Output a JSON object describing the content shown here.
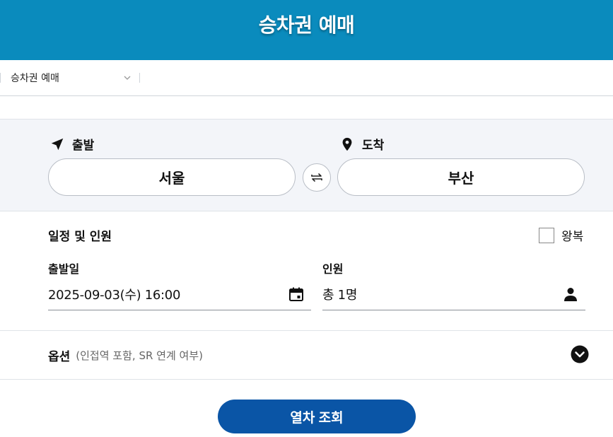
{
  "header": {
    "title": "승차권 예매"
  },
  "breadcrumb": {
    "selected": "승차권 예매"
  },
  "stations": {
    "departure_label": "출발",
    "departure_value": "서울",
    "arrival_label": "도착",
    "arrival_value": "부산"
  },
  "schedule": {
    "title": "일정 및 인원",
    "round_trip_label": "왕복",
    "round_trip_checked": false,
    "date_label": "출발일",
    "date_value": "2025-09-03(수) 16:00",
    "passengers_label": "인원",
    "passengers_value": "총 1명"
  },
  "options": {
    "title": "옵션",
    "subtitle": "(인접역 포함, SR 연계 여부)"
  },
  "actions": {
    "search_label": "열차 조회"
  },
  "colors": {
    "header_bg": "#0a8bbd",
    "station_bg": "#f3f5f9",
    "search_button": "#0a55a6"
  },
  "icons": {
    "departure": "navigation-arrow-icon",
    "arrival": "map-pin-icon",
    "swap": "swap-arrows-icon",
    "calendar": "calendar-icon",
    "person": "person-icon",
    "options_toggle": "chevron-down-circle-icon",
    "select": "chevron-down-icon"
  }
}
